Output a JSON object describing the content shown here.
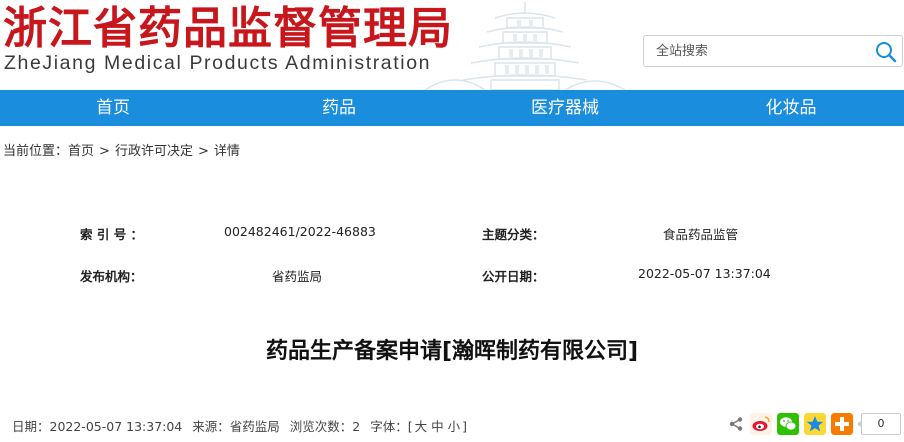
{
  "header": {
    "logo_cn": "浙江省药品监督管理局",
    "logo_en": "ZheJiang Medical Products Administration",
    "search_placeholder": "全站搜索"
  },
  "nav": {
    "items": [
      "首页",
      "药品",
      "医疗器械",
      "化妆品"
    ]
  },
  "breadcrumb": {
    "prefix": "当前位置：",
    "items": [
      "首页",
      "行政许可决定",
      "详情"
    ],
    "separator": ">"
  },
  "meta": {
    "index_label": "索 引 号 ：",
    "index_value": "002482461/2022-46883",
    "topic_label": "主题分类：",
    "topic_value": "食品药品监管",
    "publisher_label": "发布机构：",
    "publisher_value": "省药监局",
    "publish_date_label": "公开日期：",
    "publish_date_value": "2022-05-07 13:37:04"
  },
  "article": {
    "title": "药品生产备案申请[瀚晖制药有限公司]"
  },
  "info_bar": {
    "date": "日期：2022-05-07 13:37:04",
    "source": "来源：省药监局",
    "views": "浏览次数：2",
    "font_prefix": "字体：[",
    "font_large": "大",
    "font_medium": "中",
    "font_small": "小",
    "font_suffix": "]"
  },
  "share": {
    "count": "0"
  },
  "colors": {
    "brand_red": "#c8161d",
    "nav_blue": "#1a8ddc"
  }
}
